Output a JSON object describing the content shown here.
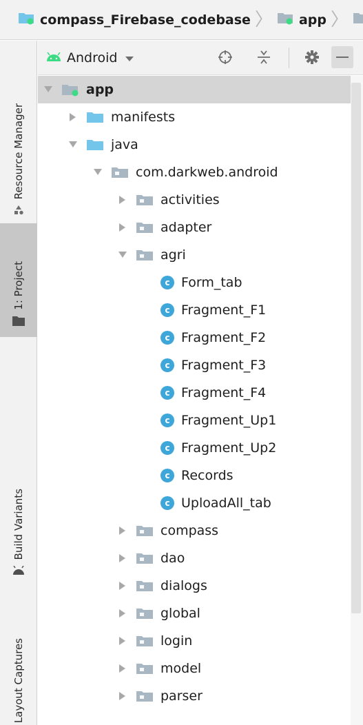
{
  "breadcrumb": {
    "items": [
      {
        "label": "compass_Firebase_codebase",
        "icon": "module-folder-icon"
      },
      {
        "label": "app",
        "icon": "module-folder-icon"
      },
      {
        "label": "",
        "icon": "folder-icon"
      }
    ]
  },
  "side_tabs": [
    {
      "label": "Resource Manager",
      "icon": "resource-manager-icon",
      "active": false
    },
    {
      "label": "1: Project",
      "icon": "folder-icon",
      "active": true
    },
    {
      "label": "Build Variants",
      "icon": "android-icon",
      "active": false
    },
    {
      "label": "Layout Captures",
      "icon": "",
      "active": false
    }
  ],
  "toolbar": {
    "view_label": "Android",
    "buttons": [
      "locate-icon",
      "collapse-all-icon",
      "gear-icon",
      "minimize-icon"
    ]
  },
  "tree": [
    {
      "label": "app",
      "depth": 0,
      "expanded": true,
      "kind": "module",
      "selected": true
    },
    {
      "label": "manifests",
      "depth": 1,
      "expanded": false,
      "kind": "folder"
    },
    {
      "label": "java",
      "depth": 1,
      "expanded": true,
      "kind": "folder"
    },
    {
      "label": "com.darkweb.android",
      "depth": 2,
      "expanded": true,
      "kind": "package"
    },
    {
      "label": "activities",
      "depth": 3,
      "expanded": false,
      "kind": "package"
    },
    {
      "label": "adapter",
      "depth": 3,
      "expanded": false,
      "kind": "package"
    },
    {
      "label": "agri",
      "depth": 3,
      "expanded": true,
      "kind": "package"
    },
    {
      "label": "Form_tab",
      "depth": 4,
      "kind": "class"
    },
    {
      "label": "Fragment_F1",
      "depth": 4,
      "kind": "class"
    },
    {
      "label": "Fragment_F2",
      "depth": 4,
      "kind": "class"
    },
    {
      "label": "Fragment_F3",
      "depth": 4,
      "kind": "class"
    },
    {
      "label": "Fragment_F4",
      "depth": 4,
      "kind": "class"
    },
    {
      "label": "Fragment_Up1",
      "depth": 4,
      "kind": "class"
    },
    {
      "label": "Fragment_Up2",
      "depth": 4,
      "kind": "class"
    },
    {
      "label": "Records",
      "depth": 4,
      "kind": "class"
    },
    {
      "label": "UploadAll_tab",
      "depth": 4,
      "kind": "class"
    },
    {
      "label": "compass",
      "depth": 3,
      "expanded": false,
      "kind": "package"
    },
    {
      "label": "dao",
      "depth": 3,
      "expanded": false,
      "kind": "package"
    },
    {
      "label": "dialogs",
      "depth": 3,
      "expanded": false,
      "kind": "package"
    },
    {
      "label": "global",
      "depth": 3,
      "expanded": false,
      "kind": "package"
    },
    {
      "label": "login",
      "depth": 3,
      "expanded": false,
      "kind": "package"
    },
    {
      "label": "model",
      "depth": 3,
      "expanded": false,
      "kind": "package"
    },
    {
      "label": "parser",
      "depth": 3,
      "expanded": false,
      "kind": "package"
    }
  ],
  "colors": {
    "folder_blue": "#74c5ea",
    "package_gray": "#a9b7c2",
    "class_badge": "#3fa6d9",
    "android_green": "#3ddc84",
    "module_dot": "#3ddc84",
    "selection": "#d5d5d5"
  }
}
